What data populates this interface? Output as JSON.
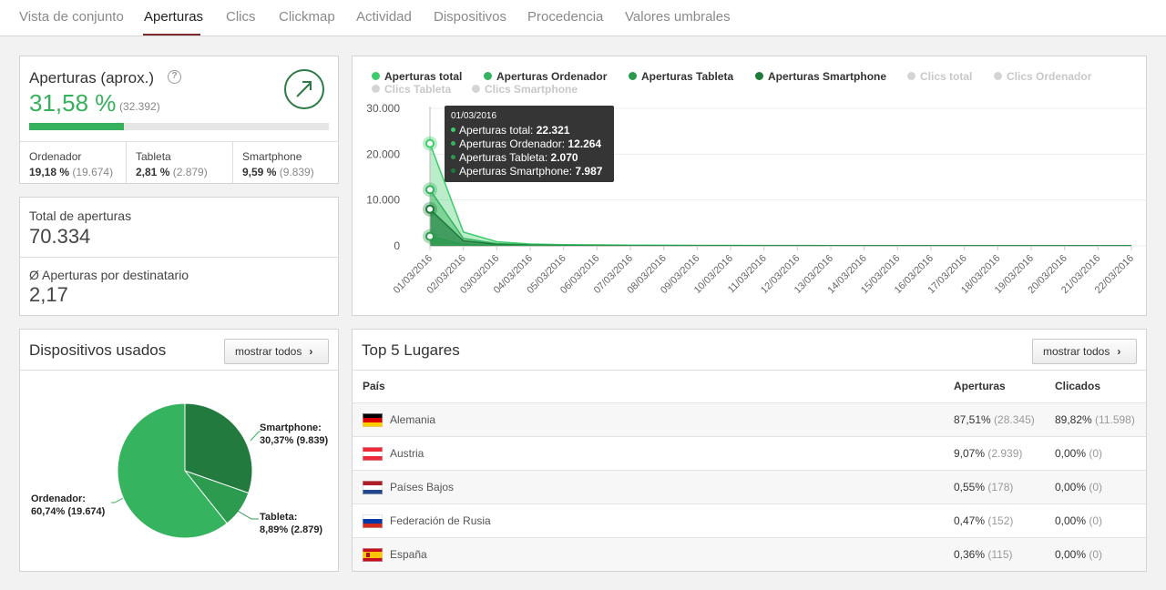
{
  "tabs": [
    "Vista de conjunto",
    "Aperturas",
    "Clics",
    "Clickmap",
    "Actividad",
    "Dispositivos",
    "Procedencia",
    "Valores umbrales"
  ],
  "active_tab": "Aperturas",
  "opens": {
    "title": "Aperturas (aprox.)",
    "help_icon": "?",
    "rate": "31,58 %",
    "count": "(32.392)",
    "progress": 0.3158,
    "devices": [
      {
        "name": "Ordenador",
        "pct": "19,18 %",
        "count": "(19.674)"
      },
      {
        "name": "Tableta",
        "pct": "2,81 %",
        "count": "(2.879)"
      },
      {
        "name": "Smartphone",
        "pct": "9,59 %",
        "count": "(9.839)"
      }
    ]
  },
  "totals": {
    "total_label": "Total de aperturas",
    "total_value": "70.334",
    "avg_label": "Ø Aperturas por destinatario",
    "avg_value": "2,17"
  },
  "chart_data": {
    "type": "area",
    "legend": [
      {
        "name": "Aperturas total",
        "color": "#3ccc6a",
        "active": true
      },
      {
        "name": "Aperturas Ordenador",
        "color": "#35b35e",
        "active": true
      },
      {
        "name": "Aperturas Tableta",
        "color": "#2a9a4c",
        "active": true
      },
      {
        "name": "Aperturas Smartphone",
        "color": "#1e7a3a",
        "active": true
      },
      {
        "name": "Clics total",
        "color": "#d4d4d4",
        "active": false
      },
      {
        "name": "Clics Ordenador",
        "color": "#d4d4d4",
        "active": false
      },
      {
        "name": "Clics Tableta",
        "color": "#d4d4d4",
        "active": false
      },
      {
        "name": "Clics Smartphone",
        "color": "#d4d4d4",
        "active": false
      }
    ],
    "x": [
      "01/03/2016",
      "02/03/2016",
      "03/03/2016",
      "04/03/2016",
      "05/03/2016",
      "06/03/2016",
      "07/03/2016",
      "08/03/2016",
      "09/03/2016",
      "10/03/2016",
      "11/03/2016",
      "12/03/2016",
      "13/03/2016",
      "14/03/2016",
      "15/03/2016",
      "16/03/2016",
      "17/03/2016",
      "18/03/2016",
      "19/03/2016",
      "20/03/2016",
      "21/03/2016",
      "22/03/2016"
    ],
    "yticks": [
      "30.000",
      "20.000",
      "10.000",
      "0"
    ],
    "ylim": [
      0,
      30000
    ],
    "series": [
      {
        "name": "Aperturas total",
        "values": [
          22321,
          3000,
          900,
          400,
          250,
          200,
          150,
          120,
          100,
          90,
          80,
          70,
          60,
          50,
          50,
          40,
          40,
          30,
          30,
          30,
          20,
          20
        ]
      },
      {
        "name": "Aperturas Ordenador",
        "values": [
          12264,
          1600,
          500,
          220,
          140,
          110,
          80,
          70,
          60,
          50,
          45,
          40,
          35,
          30,
          28,
          25,
          22,
          20,
          18,
          16,
          14,
          12
        ]
      },
      {
        "name": "Aperturas Tableta",
        "values": [
          2070,
          300,
          90,
          40,
          25,
          20,
          15,
          12,
          10,
          9,
          8,
          7,
          6,
          5,
          5,
          4,
          4,
          3,
          3,
          3,
          2,
          2
        ]
      },
      {
        "name": "Aperturas Smartphone",
        "values": [
          7987,
          1100,
          310,
          140,
          85,
          70,
          55,
          45,
          38,
          33,
          28,
          24,
          20,
          17,
          17,
          13,
          13,
          10,
          10,
          10,
          7,
          7
        ]
      }
    ],
    "tooltip": {
      "date": "01/03/2016",
      "lines": [
        {
          "label": "Aperturas total:",
          "value": "22.321",
          "color": "#3ccc6a"
        },
        {
          "label": "Aperturas Ordenador:",
          "value": "12.264",
          "color": "#35b35e"
        },
        {
          "label": "Aperturas Tableta:",
          "value": "2.070",
          "color": "#2a9a4c"
        },
        {
          "label": "Aperturas Smartphone:",
          "value": "7.987",
          "color": "#1e7a3a"
        }
      ]
    }
  },
  "devices_panel": {
    "title": "Dispositivos usados",
    "button": "mostrar todos",
    "pie": [
      {
        "name": "Ordenador",
        "label_line1": "Ordenador:",
        "label_line2": "60,74% (19.674)",
        "value": 60.74,
        "color": "#35b35e"
      },
      {
        "name": "Smartphone",
        "label_line1": "Smartphone:",
        "label_line2": "30,37% (9.839)",
        "value": 30.37,
        "color": "#237a3f"
      },
      {
        "name": "Tableta",
        "label_line1": "Tableta:",
        "label_line2": "8,89% (2.879)",
        "value": 8.89,
        "color": "#2c9a4f"
      }
    ]
  },
  "places": {
    "title": "Top 5 Lugares",
    "button": "mostrar todos",
    "headers": {
      "country": "País",
      "opens": "Aperturas",
      "clicks": "Clicados"
    },
    "rows": [
      {
        "flag": "de",
        "country": "Alemania",
        "opens_pct": "87,51%",
        "opens_cnt": "(28.345)",
        "clicks_pct": "89,82%",
        "clicks_cnt": "(11.598)"
      },
      {
        "flag": "at",
        "country": "Austria",
        "opens_pct": "9,07%",
        "opens_cnt": "(2.939)",
        "clicks_pct": "0,00%",
        "clicks_cnt": "(0)"
      },
      {
        "flag": "nl",
        "country": "Países Bajos",
        "opens_pct": "0,55%",
        "opens_cnt": "(178)",
        "clicks_pct": "0,00%",
        "clicks_cnt": "(0)"
      },
      {
        "flag": "ru",
        "country": "Federación de Rusia",
        "opens_pct": "0,47%",
        "opens_cnt": "(152)",
        "clicks_pct": "0,00%",
        "clicks_cnt": "(0)"
      },
      {
        "flag": "es",
        "country": "España",
        "opens_pct": "0,36%",
        "opens_cnt": "(115)",
        "clicks_pct": "0,00%",
        "clicks_cnt": "(0)"
      }
    ]
  }
}
